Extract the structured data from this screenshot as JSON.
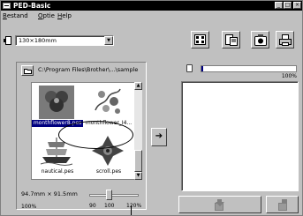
{
  "window": {
    "title": "PED-Basic"
  },
  "title_buttons": {
    "minimize": "_",
    "maximize": "□",
    "close": "×"
  },
  "menu": [
    "Bestand",
    "Optie",
    "Help"
  ],
  "toolbar": {
    "hoop_size": "130×180mm",
    "dropdown_arrow": "▼",
    "icons": [
      "layout-grid-icon",
      "file-properties-icon",
      "write-card-icon",
      "print-icon"
    ]
  },
  "left_pane": {
    "path": "C:\\Program Files\\Brother\\...\\sample",
    "files": [
      {
        "label": "monthflower8.pes",
        "selected": true,
        "thumb": "blue-flower-icon"
      },
      {
        "label": "monthflower_I4...",
        "selected": false,
        "thumb": "red-floral-icon"
      },
      {
        "label": "nautical.pes",
        "selected": false,
        "thumb": "sailing-ship-icon"
      },
      {
        "label": "scroll.pes",
        "selected": false,
        "thumb": "ornament-scroll-icon"
      }
    ],
    "design_size": "94.7mm × 91.5mm",
    "scale_percent": "100%",
    "zoom": {
      "min_label": "90",
      "mid_label": "100",
      "max_label": "120%",
      "value": 100,
      "min": 90,
      "max": 120
    }
  },
  "transfer_arrow": "➔",
  "right_pane": {
    "capacity_label": "100%",
    "capacity_fill_percent": 2
  },
  "bottom_buttons": [
    "transfer-to-card-icon",
    "delete-from-card-icon"
  ],
  "colors": {
    "selection": "#000080",
    "face": "#c0c0c0",
    "titlebar": "#000000"
  }
}
